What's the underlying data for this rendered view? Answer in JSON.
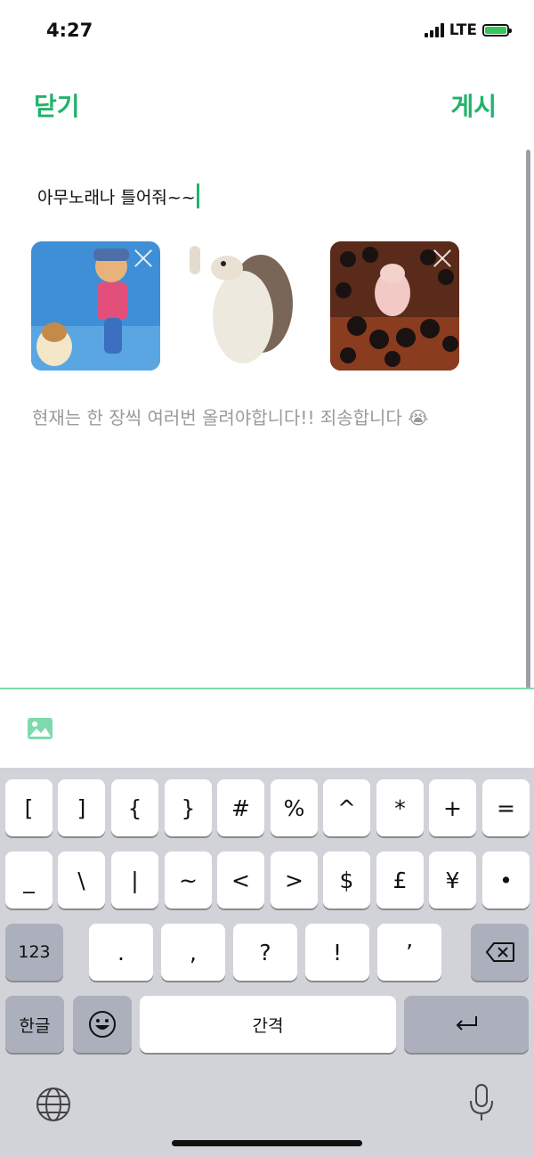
{
  "status_bar": {
    "time": "4:27",
    "network": "LTE"
  },
  "header": {
    "close_label": "닫기",
    "post_label": "게시"
  },
  "composer": {
    "text": "아무노래나 틀어줘~~",
    "notice": "현재는 한 장씩 여러번 올려야합니다!! 죄송합니다 😭"
  },
  "attachments": [
    {
      "name": "cartoon-man-and-cat",
      "remove_icon": "close-icon"
    },
    {
      "name": "waving-hedgehog",
      "remove_icon": "close-icon"
    },
    {
      "name": "soot-sprites-creature",
      "remove_icon": "close-icon"
    }
  ],
  "toolbar": {
    "gallery_icon": "image-icon"
  },
  "keyboard": {
    "row1": [
      "[",
      "]",
      "{",
      "}",
      "#",
      "%",
      "^",
      "*",
      "+",
      "="
    ],
    "row2": [
      "_",
      "\\",
      "|",
      "~",
      "<",
      ">",
      "$",
      "£",
      "¥",
      "•"
    ],
    "row3": [
      ".",
      ",",
      "?",
      "!",
      "’"
    ],
    "mode_123": "123",
    "lang_key": "한글",
    "space": "간격",
    "icons": {
      "emoji": "emoji-icon",
      "return": "return-icon",
      "backspace": "backspace-icon",
      "globe": "globe-icon",
      "mic": "microphone-icon"
    }
  },
  "colors": {
    "accent": "#1fb36b",
    "keyboard_bg": "#d1d3d9",
    "notice": "#9a9a9a"
  }
}
